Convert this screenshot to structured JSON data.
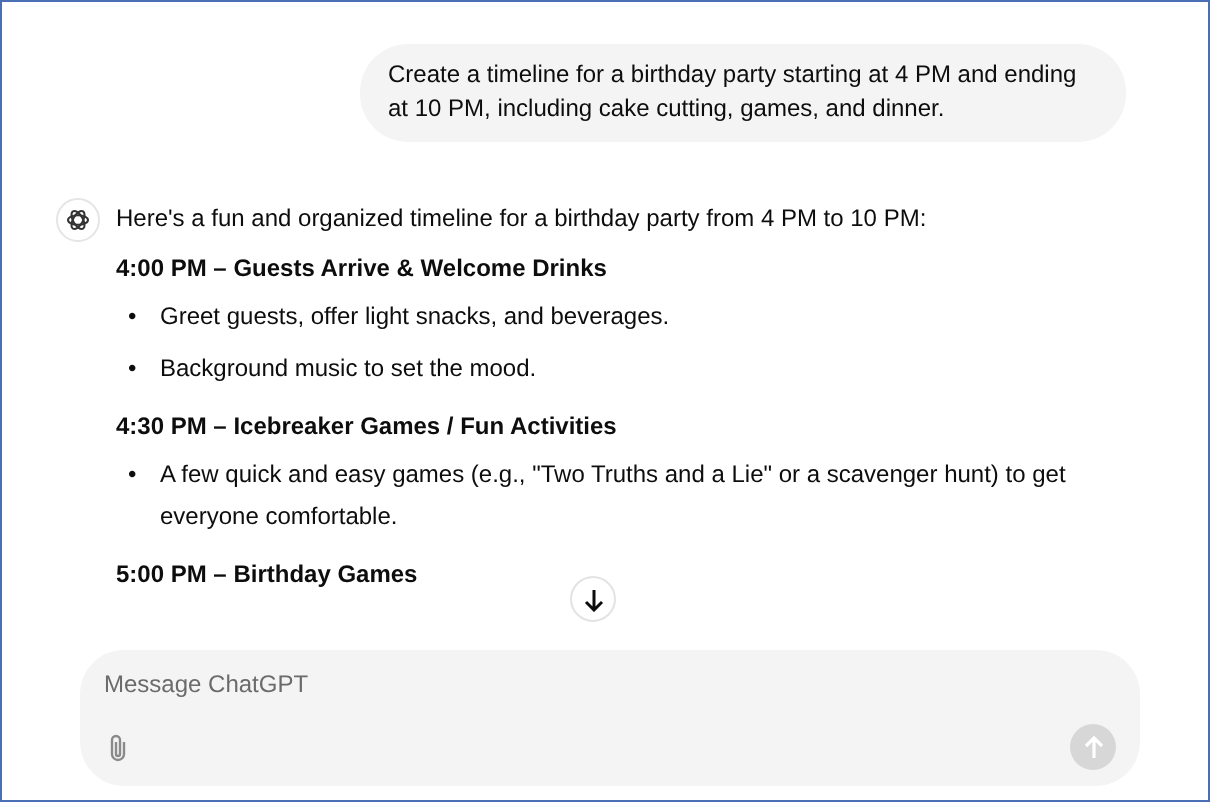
{
  "user_message": "Create a timeline for a birthday party starting at 4 PM and ending at 10 PM, including cake cutting, games, and dinner.",
  "assistant_message": {
    "intro": "Here's a fun and organized timeline for a birthday party from 4 PM to 10 PM:",
    "sections": [
      {
        "heading": "4:00 PM – Guests Arrive & Welcome Drinks",
        "bullets": [
          "Greet guests, offer light snacks, and beverages.",
          "Background music to set the mood."
        ]
      },
      {
        "heading": "4:30 PM – Icebreaker Games / Fun Activities",
        "bullets": [
          "A few quick and easy games (e.g., \"Two Truths and a Lie\" or a scavenger hunt) to get everyone comfortable."
        ]
      },
      {
        "heading": "5:00 PM – Birthday Games"
      }
    ],
    "bullet_marker": "•"
  },
  "composer": {
    "placeholder": "Message ChatGPT",
    "send_disabled": true
  }
}
